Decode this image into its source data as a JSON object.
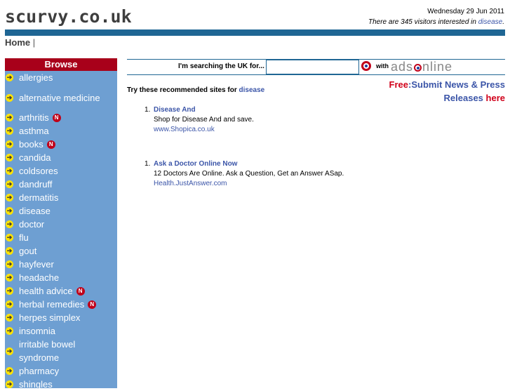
{
  "site": {
    "logo": "scurvy.co.uk",
    "date": "Wednesday 29 Jun 2011",
    "visitors_prefix": "There are 345 visitors interested in ",
    "visitors_topic": "disease",
    "visitors_suffix": "."
  },
  "breadcrumb": {
    "home": "Home",
    "sep": "|"
  },
  "sidebar": {
    "title": "Browse",
    "new_badge": "N",
    "items": [
      {
        "label": "allergies",
        "new": false
      },
      {
        "label": "alternative medicine",
        "new": false
      },
      {
        "label": "arthritis",
        "new": true
      },
      {
        "label": "asthma",
        "new": false
      },
      {
        "label": "books",
        "new": true
      },
      {
        "label": "candida",
        "new": false
      },
      {
        "label": "coldsores",
        "new": false
      },
      {
        "label": "dandruff",
        "new": false
      },
      {
        "label": "dermatitis",
        "new": false
      },
      {
        "label": "disease",
        "new": false
      },
      {
        "label": "doctor",
        "new": false
      },
      {
        "label": "flu",
        "new": false
      },
      {
        "label": "gout",
        "new": false
      },
      {
        "label": "hayfever",
        "new": false
      },
      {
        "label": "headache",
        "new": false
      },
      {
        "label": "health advice",
        "new": true
      },
      {
        "label": "herbal remedies",
        "new": true
      },
      {
        "label": "herpes simplex",
        "new": false
      },
      {
        "label": "insomnia",
        "new": false
      },
      {
        "label": "irritable bowel syndrome",
        "new": false
      },
      {
        "label": "pharmacy",
        "new": false
      },
      {
        "label": "shingles",
        "new": false
      }
    ]
  },
  "search": {
    "label": "I'm searching the UK for...",
    "value": "",
    "with": "with",
    "brand_pre": "ads",
    "brand_post": "nline"
  },
  "recommend": {
    "prefix": "Try these recommended sites for ",
    "topic": "disease"
  },
  "promo": {
    "free": "Free",
    "line1": ":Submit News & Press",
    "line2": "Releases ",
    "here": "here"
  },
  "results": [
    {
      "num": "1.",
      "title": "Disease And",
      "desc": "Shop for Disease And and save.",
      "url": "www.Shopica.co.uk"
    },
    {
      "num": "1.",
      "title": "Ask a Doctor Online Now",
      "desc": "12 Doctors Are Online. Ask a Question, Get an Answer ASap.",
      "url": "Health.JustAnswer.com"
    }
  ],
  "colors": {
    "accent_blue": "#1f6694",
    "sidebar_bg": "#6e9fd2",
    "browse_red": "#a8001a",
    "link": "#3b55a8"
  }
}
